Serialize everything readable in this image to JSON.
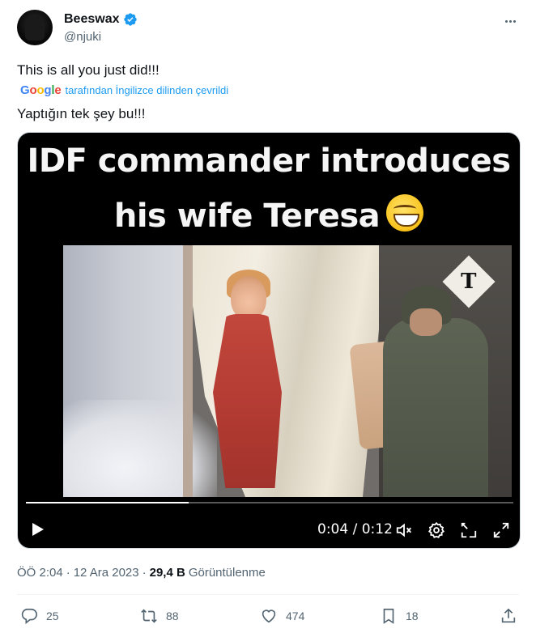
{
  "author": {
    "display_name": "Beeswax",
    "handle": "@njuki",
    "verified_color": "#1d9bf0"
  },
  "tweet": {
    "text": "This is all you just did!!!",
    "translation_attribution": "tarafından İngilizce dilinden çevrildi",
    "translation_provider": "Google",
    "translated_text": "Yaptığın tek şey bu!!!"
  },
  "video": {
    "caption_line1": "IDF commander introduces",
    "caption_line2": "his wife Teresa",
    "caption_emoji": "grinning-face",
    "watermark": "T",
    "time_display": "0:04 / 0:12",
    "progress": 0.3333
  },
  "meta": {
    "time": "ÖÖ 2:04",
    "separator1": "·",
    "date": "12 Ara 2023",
    "separator2": "·",
    "views_count": "29,4 B",
    "views_label": "Görüntülenme"
  },
  "actions": {
    "replies": "25",
    "reposts": "88",
    "likes": "474",
    "bookmarks": "18"
  },
  "colors": {
    "text_primary": "#0f1419",
    "text_secondary": "#536471",
    "accent": "#1d9bf0"
  }
}
